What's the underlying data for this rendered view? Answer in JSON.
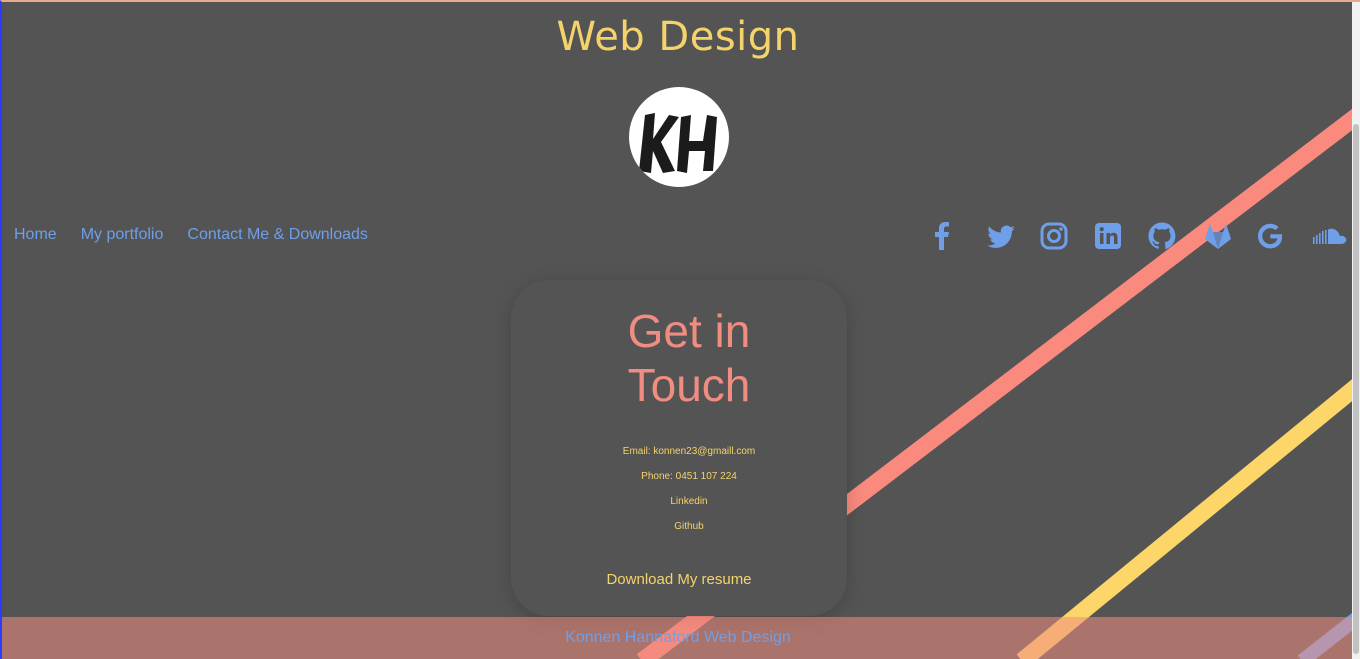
{
  "header": {
    "site_title": "Web Design",
    "logo_text": "KH"
  },
  "nav": {
    "items": [
      {
        "label": "Home"
      },
      {
        "label": "My portfolio"
      },
      {
        "label": "Contact Me & Downloads"
      }
    ]
  },
  "social": {
    "icons": [
      "facebook-icon",
      "twitter-icon",
      "instagram-icon",
      "linkedin-icon",
      "github-icon",
      "gitlab-icon",
      "google-icon",
      "soundcloud-icon"
    ]
  },
  "contact": {
    "title_line1": "Get in",
    "title_line2": "Touch",
    "email": "Email: konnen23@gmaill.com",
    "phone": "Phone: 0451 107 224",
    "linkedin": "Linkedin",
    "github": "Github",
    "resume_link": "Download My resume"
  },
  "footer": {
    "text": "Konnen Hannaford Web Design"
  },
  "colors": {
    "background": "#545454",
    "title_yellow": "#f5d36b",
    "link_blue": "#6f9fe8",
    "accent_salmon": "#f18c80"
  }
}
